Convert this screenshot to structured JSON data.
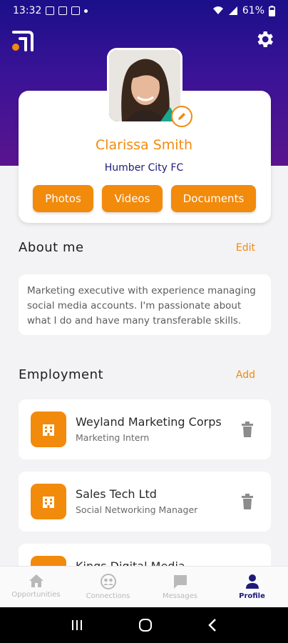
{
  "status_bar": {
    "time": "13:32",
    "battery": "61%"
  },
  "colors": {
    "accent": "#f28a0c",
    "brand": "#1e1a7a",
    "header_gradient_top": "#1b0f8a",
    "header_gradient_bottom": "#5a148f"
  },
  "profile": {
    "name": "Clarissa Smith",
    "club": "Humber City FC",
    "buttons": {
      "photos": "Photos",
      "videos": "Videos",
      "documents": "Documents"
    }
  },
  "about": {
    "title": "About me",
    "action": "Edit",
    "text": "Marketing executive with experience managing social media accounts. I'm passionate about what I do and have many transferable skills."
  },
  "employment": {
    "title": "Employment",
    "action": "Add",
    "items": [
      {
        "company": "Weyland Marketing Corps",
        "role": "Marketing Intern"
      },
      {
        "company": "Sales Tech Ltd",
        "role": "Social Networking Manager"
      },
      {
        "company": "Kings Digital Media",
        "role": ""
      }
    ]
  },
  "bottom_nav": [
    {
      "label": "Opportunities",
      "icon": "home-icon",
      "active": false
    },
    {
      "label": "Connections",
      "icon": "connections-icon",
      "active": false
    },
    {
      "label": "Messages",
      "icon": "chat-icon",
      "active": false
    },
    {
      "label": "Profile",
      "icon": "person-icon",
      "active": true
    }
  ]
}
